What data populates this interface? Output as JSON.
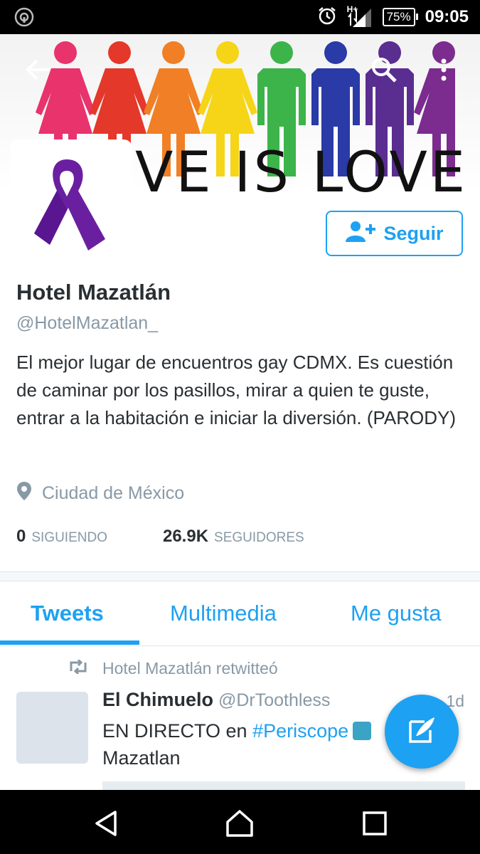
{
  "status_bar": {
    "network": "H+",
    "battery": "75%",
    "time": "09:05"
  },
  "header": {
    "banner_text": "VE IS LOVE",
    "figure_colors": [
      "#e8336d",
      "#e4382a",
      "#f07f25",
      "#f6d418",
      "#3cb44a",
      "#2a3aa6",
      "#5a2d91",
      "#7b2c8e"
    ]
  },
  "follow_button": {
    "label": "Seguir"
  },
  "profile": {
    "name": "Hotel Mazatlán",
    "handle": "@HotelMazatlan_",
    "bio": "El mejor lugar de encuentros gay CDMX. Es cuestión de caminar por los pasillos, mirar a quien te guste, entrar a la habitación e iniciar la diversión. (PARODY)",
    "location": "Ciudad de México"
  },
  "stats": {
    "following_count": "0",
    "following_label": "SIGUIENDO",
    "followers_count": "26.9K",
    "followers_label": "SEGUIDORES"
  },
  "tabs": [
    {
      "label": "Tweets"
    },
    {
      "label": "Multimedia"
    },
    {
      "label": "Me gusta"
    }
  ],
  "tweet": {
    "retweet_label": "Hotel Mazatlán retwitteó",
    "author_name": "El Chimuelo",
    "author_handle": "@DrToothless",
    "time": "1d",
    "text_prefix": "EN DIRECTO en",
    "hashtag": "#Periscope",
    "text_suffix": "Mazatlan"
  },
  "colors": {
    "accent": "#1da1f2",
    "secondary_text": "#8899a6",
    "primary_text": "#292f33",
    "ribbon": "#6a1fa0"
  }
}
